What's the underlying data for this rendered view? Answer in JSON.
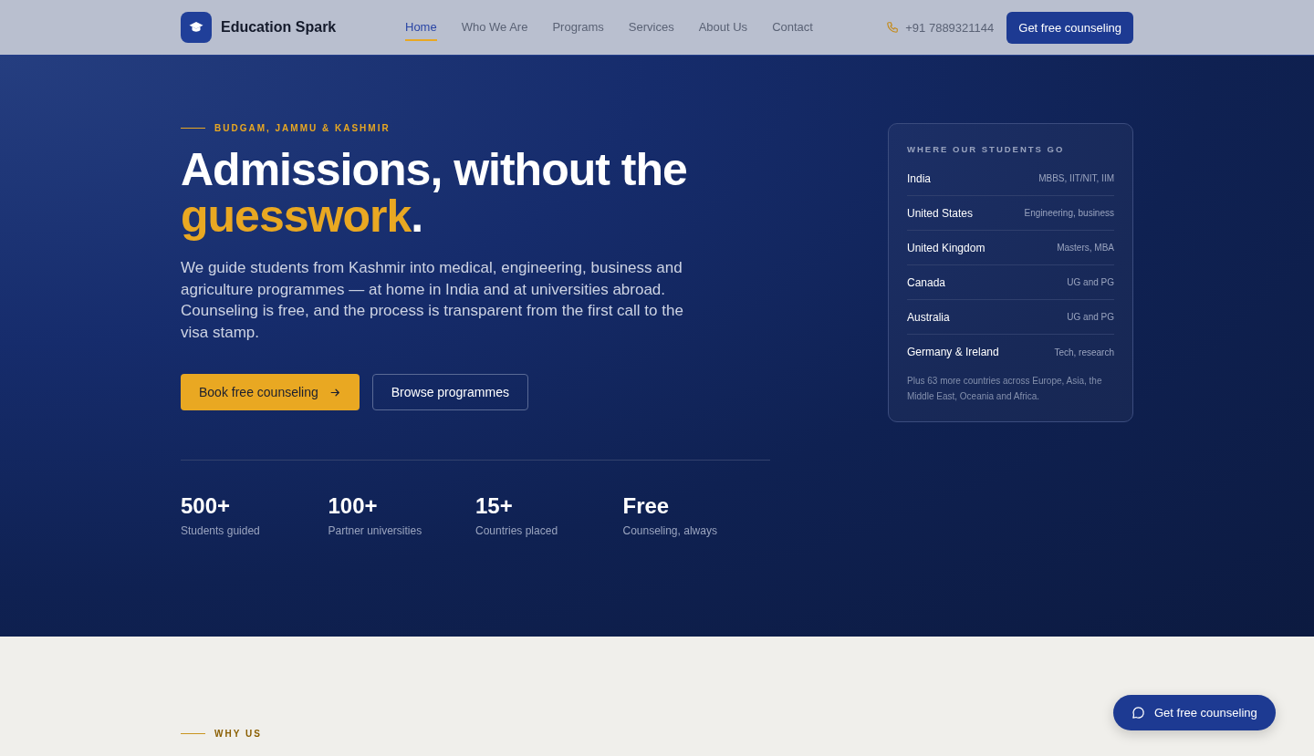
{
  "header": {
    "brand": "Education Spark",
    "nav": [
      {
        "label": "Home",
        "selected": true
      },
      {
        "label": "Who We Are",
        "selected": false
      },
      {
        "label": "Programs",
        "selected": false
      },
      {
        "label": "Services",
        "selected": false
      },
      {
        "label": "About Us",
        "selected": false
      },
      {
        "label": "Contact",
        "selected": false
      }
    ],
    "phone": "+91 7889321144",
    "cta": "Get free counseling"
  },
  "hero": {
    "eyebrow": "BUDGAM, JAMMU & KASHMIR",
    "heading": {
      "before": "Admissions, without the ",
      "highlight": "guesswork",
      "after": "."
    },
    "lead": "We guide students from Kashmir into medical, engineering, business and agriculture programmes — at home in India and at universities abroad. Counseling is free, and the process is transparent from the first call to the visa stamp.",
    "buttons": [
      {
        "label": "Book free counseling",
        "kind": "primary"
      },
      {
        "label": "Browse programmes",
        "kind": "outline"
      }
    ],
    "stats": [
      {
        "value": "500+",
        "label": "Students guided"
      },
      {
        "value": "100+",
        "label": "Partner universities"
      },
      {
        "value": "15+",
        "label": "Countries placed"
      },
      {
        "value": "Free",
        "label": "Counseling, always"
      }
    ]
  },
  "destinations": {
    "title": "WHERE OUR STUDENTS GO",
    "rows": [
      {
        "country": "India",
        "programmes": "MBBS, IIT/NIT, IIM"
      },
      {
        "country": "United States",
        "programmes": "Engineering, business"
      },
      {
        "country": "United Kingdom",
        "programmes": "Masters, MBA"
      },
      {
        "country": "Canada",
        "programmes": "UG and PG"
      },
      {
        "country": "Australia",
        "programmes": "UG and PG"
      },
      {
        "country": "Germany & Ireland",
        "programmes": "Tech, research"
      }
    ],
    "note": "Plus 63 more countries across Europe, Asia, the Middle East, Oceania and Africa."
  },
  "why_us": {
    "eyebrow": "WHY US"
  },
  "floating_button": {
    "label": "Get free counseling"
  }
}
